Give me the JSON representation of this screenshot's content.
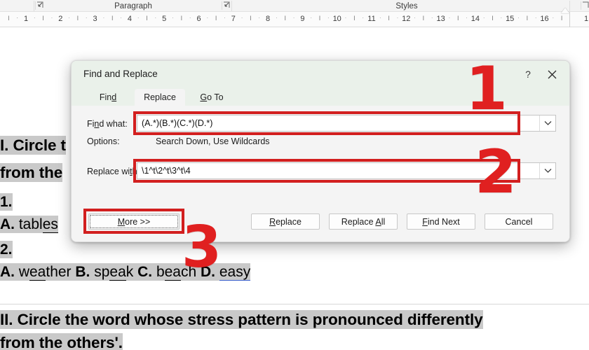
{
  "ribbon": {
    "groups": [
      {
        "label": "Paragraph"
      },
      {
        "label": "Styles"
      }
    ],
    "launcher_glyph": "⌐"
  },
  "ruler": {
    "numbers": [
      "1",
      "2",
      "3",
      "4",
      "5",
      "6",
      "7",
      "8",
      "9",
      "10",
      "11",
      "12",
      "13",
      "14",
      "15",
      "16"
    ],
    "minor_tick": "I",
    "minor_dot": "·"
  },
  "dialog": {
    "title": "Find and Replace",
    "help_label": "?",
    "close_label": "✕",
    "tabs": [
      {
        "label_pre": "Fin",
        "label_key": "d",
        "label_post": "",
        "name": "find"
      },
      {
        "label_pre": "Replace",
        "label_key": "",
        "label_post": "",
        "name": "replace"
      },
      {
        "label_pre": "",
        "label_key": "G",
        "label_post": "o To",
        "name": "goto"
      }
    ],
    "active_tab": "Replace",
    "find_label_pre": "Fi",
    "find_label_key": "n",
    "find_label_post": "d what:",
    "find_value": "(A.*)(B.*)(C.*)(D.*)",
    "find_placeholder": "",
    "options_label": "Options:",
    "options_value": "Search Down, Use Wildcards",
    "replace_label_pre": "Replace wi",
    "replace_label_key": "t",
    "replace_label_post": "h:",
    "replace_value": "\\1^t\\2^t\\3^t\\4",
    "replace_placeholder": "",
    "dropdown_glyph": "⌄",
    "buttons": {
      "more": {
        "pre": "",
        "key": "M",
        "post": "ore >>"
      },
      "replace": {
        "pre": "",
        "key": "R",
        "post": "eplace"
      },
      "replace_all": {
        "pre": "Replace ",
        "key": "A",
        "post": "ll"
      },
      "find_next": {
        "pre": "",
        "key": "F",
        "post": "ind Next"
      },
      "cancel": {
        "pre": "Cancel",
        "key": "",
        "post": ""
      }
    }
  },
  "annotations": {
    "step_1": "1",
    "step_2": "2",
    "step_3": "3",
    "color": "#e02020"
  },
  "document": {
    "lines": [
      {
        "text": "I. Circle the word whose stress pattern is pronounced differently",
        "style": "heading"
      },
      {
        "text": "from the others'.",
        "style": "heading"
      },
      {
        "text": "1.",
        "style": "number"
      },
      {
        "text": "A. tables B. speak C. beach D. easy",
        "style": "options"
      },
      {
        "text": "2.",
        "style": "number"
      },
      {
        "text": "A. weather B. speak C. beach D. easy",
        "style": "options"
      },
      {
        "text": "II. Circle the word whose stress pattern is pronounced differently",
        "style": "heading"
      },
      {
        "text": "from the others'.",
        "style": "heading"
      }
    ],
    "line_1_visible": "I. Circle t",
    "line_2_visible": "from the",
    "line_3_visible": "1.",
    "line_4_visible": "A. tables",
    "line_5_visible": "2.",
    "line_6_a": "A.",
    "line_6_w1": "weather",
    "line_6_b": "B.",
    "line_6_w2": "speak",
    "line_6_c": "C.",
    "line_6_w3": "beach",
    "line_6_d": "D.",
    "line_6_w4": "easy",
    "line_7": "II. Circle the word whose stress pattern is pronounced differently",
    "line_8": "from the others'."
  }
}
